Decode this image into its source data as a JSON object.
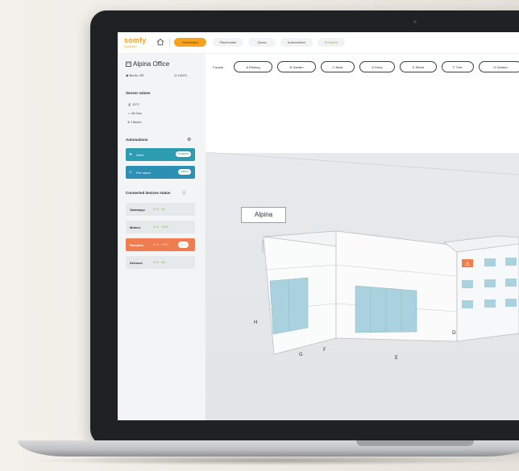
{
  "app": {
    "logo": "somfy",
    "logo_sub": "Architect",
    "nav_tabs": [
      {
        "label": "Dashboard",
        "active": true
      },
      {
        "label": "Placeholder",
        "active": false
      },
      {
        "label": "Zones",
        "active": false
      },
      {
        "label": "Automations",
        "active": false
      },
      {
        "label": "SomfyGo",
        "active": false
      }
    ]
  },
  "sidebar": {
    "site_name": "Alpina Office",
    "location": "Berlin, DE",
    "time": "12h23",
    "sensor_heading": "Sensor values",
    "sensors": [
      "20°C",
      "46 Klux",
      "13km/h"
    ],
    "automations_heading": "Automations",
    "automations": [
      {
        "label": "Wind",
        "state": "Enabled"
      },
      {
        "label": "Fire alarm",
        "state": "Select"
      }
    ],
    "devices_heading": "Connected devices status",
    "devices": [
      {
        "name": "Gateways",
        "count": "4/4",
        "alert": false,
        "badge": ""
      },
      {
        "name": "Motors",
        "count": "76/76",
        "alert": false,
        "badge": ""
      },
      {
        "name": "Remotes",
        "count": "12/13",
        "alert": true,
        "badge": "1"
      },
      {
        "name": "Sensors",
        "count": "5/5",
        "alert": false,
        "badge": ""
      }
    ]
  },
  "facade": {
    "label": "Facade",
    "chips": [
      "A  Parking",
      "B  Garden",
      "C  Back",
      "D  Entry",
      "E  Street",
      "F  Tree",
      "G  Garden"
    ]
  },
  "building": {
    "name": "Alpina",
    "side_labels": [
      "H",
      "G",
      "F",
      "E",
      "D"
    ]
  },
  "colors": {
    "accent": "#f6a21e",
    "teal": "#2c9cb0",
    "alert": "#ef7d4f",
    "ok": "#7fb843"
  }
}
